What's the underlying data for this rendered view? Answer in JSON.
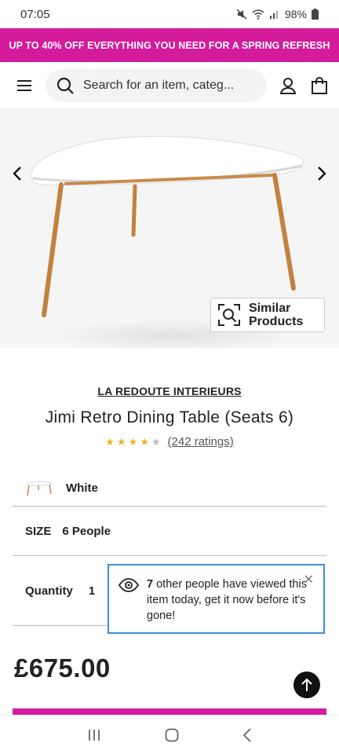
{
  "status_bar": {
    "time": "07:05",
    "battery": "98%"
  },
  "promo": {
    "text": "UP TO 40% OFF EVERYTHING YOU NEED FOR A SPRING REFRESH",
    "color": "#d41b9b"
  },
  "header": {
    "search_placeholder": "Search for an item, categ..."
  },
  "hero": {
    "similar_label_line1": "Similar",
    "similar_label_line2": "Products"
  },
  "product": {
    "brand": "LA REDOUTE INTERIEURS",
    "title": "Jimi Retro Dining Table (Seats 6)",
    "rating_stars": 4,
    "rating_text": "(242 ratings)",
    "colour": "White",
    "size_label": "SIZE",
    "size_value": "6 People",
    "quantity_label": "Quantity",
    "quantity_value": "1",
    "price": "£675.00"
  },
  "toast": {
    "count": "7",
    "message": " other people have viewed this item today, get it now before it's gone!"
  }
}
